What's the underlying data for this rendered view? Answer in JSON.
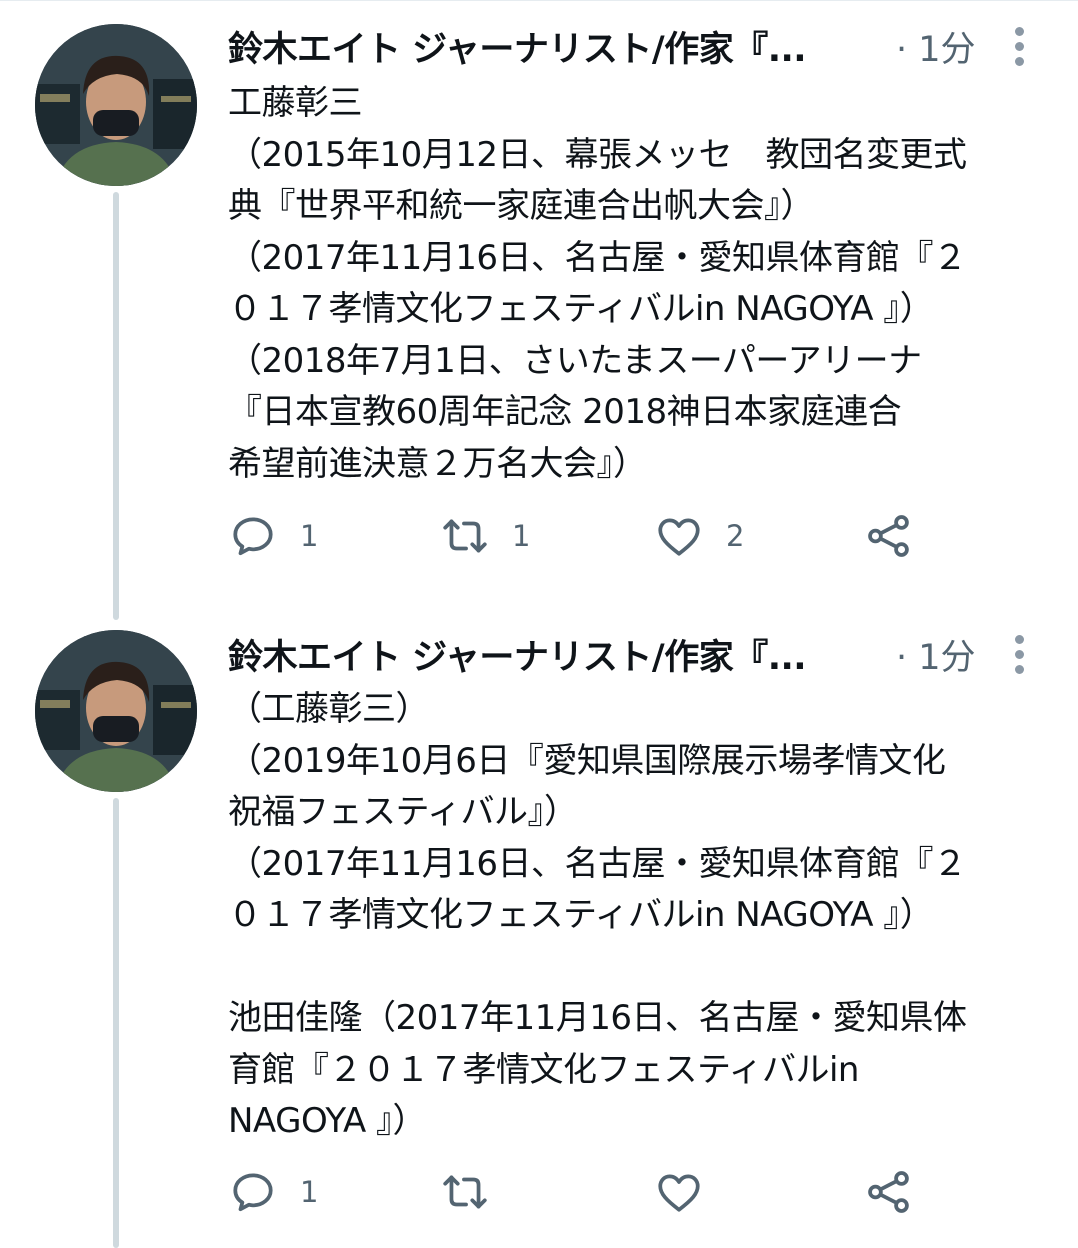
{
  "tweets": [
    {
      "author": "鈴木エイト ジャーナリスト/作家『...",
      "time": "· 1分",
      "lines": [
        "工藤彰三",
        "（2015年10月12日、幕張メッセ　教団名変更式",
        "典『世界平和統一家庭連合出帆大会』）",
        "（2017年11月16日、名古屋・愛知県体育館『２",
        "０１７孝情文化フェスティバルin NAGOYA 』）",
        "（2018年7月1日、さいたまスーパーアリーナ",
        "『日本宣教60周年記念 2018神日本家庭連合",
        "希望前進決意２万名大会』）"
      ],
      "actions": {
        "reply_count": "1",
        "retweet_count": "1",
        "like_count": "2",
        "share_count": ""
      }
    },
    {
      "author": "鈴木エイト ジャーナリスト/作家『...",
      "time": "· 1分",
      "lines": [
        "（工藤彰三）",
        "（2019年10月6日『愛知県国際展示場孝情文化",
        "祝福フェスティバル』）",
        "（2017年11月16日、名古屋・愛知県体育館『２",
        "０１７孝情文化フェスティバルin NAGOYA 』）",
        "",
        "池田佳隆（2017年11月16日、名古屋・愛知県体",
        "育館『２０１７孝情文化フェスティバルin",
        "NAGOYA 』）"
      ],
      "actions": {
        "reply_count": "1",
        "retweet_count": "",
        "like_count": "",
        "share_count": ""
      }
    }
  ],
  "icons": {
    "avatar": "avatar-photo",
    "more": "more-vertical-icon",
    "reply": "reply-icon",
    "retweet": "retweet-icon",
    "like": "heart-icon",
    "share": "share-icon"
  },
  "colors": {
    "text": "#0f1419",
    "secondary": "#536471",
    "thread_line": "#cfd9de",
    "icon": "#536471"
  }
}
